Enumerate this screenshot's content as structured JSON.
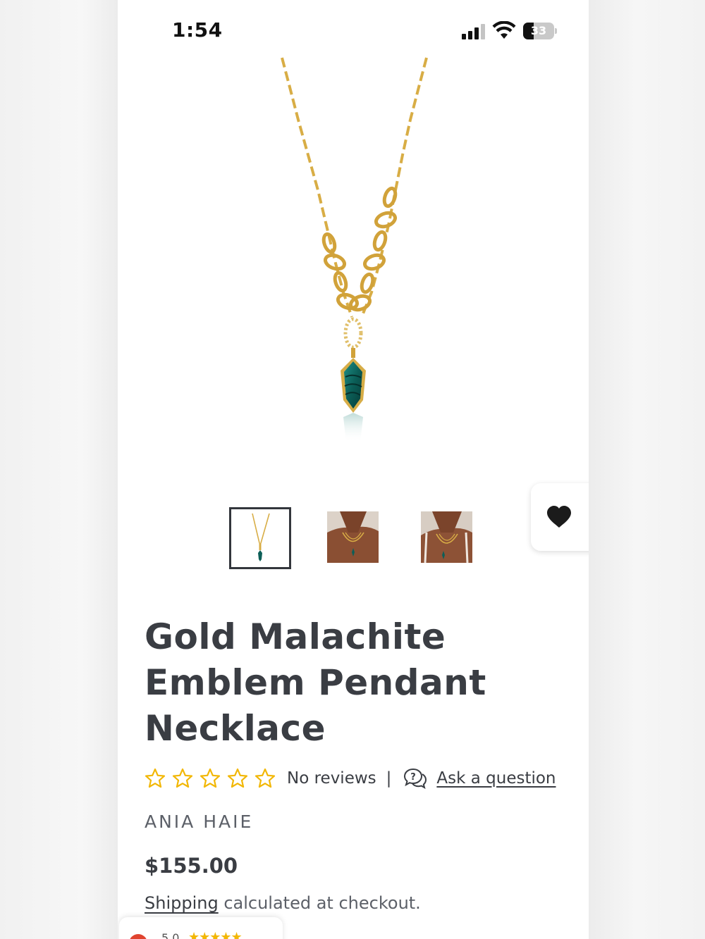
{
  "status_bar": {
    "time": "1:54",
    "battery_percent": "33",
    "battery_level": 0.33,
    "signal_icon": "cellular-signal-icon",
    "wifi_icon": "wifi-icon"
  },
  "product": {
    "image_alt_icon": "necklace-product-image",
    "thumbnails": [
      {
        "icon": "necklace-thumbnail",
        "selected": true
      },
      {
        "icon": "model-wearing-necklace-thumbnail",
        "selected": false
      },
      {
        "icon": "model-wearing-necklace-thumbnail",
        "selected": false
      }
    ],
    "wishlist_icon": "heart-icon",
    "title": "Gold Malachite Emblem Pendant Necklace",
    "rating": {
      "stars_filled": 0,
      "stars_total": 5,
      "reviews_text": "No reviews",
      "separator": "|",
      "ask_icon": "question-chat-icon",
      "ask_label": "Ask a question"
    },
    "brand": "ANIA HAIE",
    "price": "$155.00",
    "shipping_link": "Shipping",
    "shipping_text": " calculated at checkout."
  },
  "review_badge": {
    "score": "5.0",
    "stars": "★★★★★"
  },
  "colors": {
    "text": "#3a3d43",
    "star_outline": "#f2b705",
    "gold": "#d9b24a",
    "malachite": "#0f6e66"
  }
}
